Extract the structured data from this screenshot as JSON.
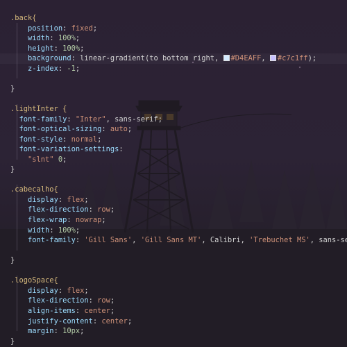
{
  "editor": {
    "lines": [
      [
        {
          "t": ".back{",
          "c": "sel"
        }
      ],
      [
        {
          "t": "    "
        },
        {
          "t": "position",
          "c": "prop"
        },
        {
          "t": ": "
        },
        {
          "t": "fixed",
          "c": "val"
        },
        {
          "t": ";"
        }
      ],
      [
        {
          "t": "    "
        },
        {
          "t": "width",
          "c": "prop"
        },
        {
          "t": ": "
        },
        {
          "t": "100%",
          "c": "num"
        },
        {
          "t": ";"
        }
      ],
      [
        {
          "t": "    "
        },
        {
          "t": "height",
          "c": "prop"
        },
        {
          "t": ": "
        },
        {
          "t": "100%",
          "c": "num"
        },
        {
          "t": ";"
        }
      ],
      [
        {
          "t": "    "
        },
        {
          "t": "background",
          "c": "prop"
        },
        {
          "t": ": linear-gradient(to bottom right, "
        },
        {
          "sw": "#D4EAFF"
        },
        {
          "t": "#D4EAFF",
          "c": "val"
        },
        {
          "t": ", "
        },
        {
          "sw": "#c7c1ff"
        },
        {
          "t": "#c7c1ff",
          "c": "val"
        },
        {
          "t": ");"
        }
      ],
      [
        {
          "t": "    "
        },
        {
          "t": "z-index",
          "c": "prop"
        },
        {
          "t": ": "
        },
        {
          "t": "-1",
          "c": "num"
        },
        {
          "t": ";"
        }
      ],
      [],
      [
        {
          "t": "}"
        }
      ],
      [],
      [
        {
          "t": ".lightInter {",
          "c": "sel"
        }
      ],
      [
        {
          "t": "  "
        },
        {
          "t": "font-family",
          "c": "prop"
        },
        {
          "t": ": "
        },
        {
          "t": "\"Inter\"",
          "c": "val"
        },
        {
          "t": ", sans-serif;"
        }
      ],
      [
        {
          "t": "  "
        },
        {
          "t": "font-optical-sizing",
          "c": "prop"
        },
        {
          "t": ": "
        },
        {
          "t": "auto",
          "c": "val"
        },
        {
          "t": ";"
        }
      ],
      [
        {
          "t": "  "
        },
        {
          "t": "font-style",
          "c": "prop"
        },
        {
          "t": ": "
        },
        {
          "t": "normal",
          "c": "val"
        },
        {
          "t": ";"
        }
      ],
      [
        {
          "t": "  "
        },
        {
          "t": "font-variation-settings",
          "c": "prop"
        },
        {
          "t": ":"
        }
      ],
      [
        {
          "t": "    "
        },
        {
          "t": "\"slnt\"",
          "c": "val"
        },
        {
          "t": " "
        },
        {
          "t": "0",
          "c": "num"
        },
        {
          "t": ";"
        }
      ],
      [
        {
          "t": "}"
        }
      ],
      [],
      [
        {
          "t": ".cabecalho{",
          "c": "sel"
        }
      ],
      [
        {
          "t": "    "
        },
        {
          "t": "display",
          "c": "prop"
        },
        {
          "t": ": "
        },
        {
          "t": "flex",
          "c": "val"
        },
        {
          "t": ";"
        }
      ],
      [
        {
          "t": "    "
        },
        {
          "t": "flex-direction",
          "c": "prop"
        },
        {
          "t": ": "
        },
        {
          "t": "row",
          "c": "val"
        },
        {
          "t": ";"
        }
      ],
      [
        {
          "t": "    "
        },
        {
          "t": "flex-wrap",
          "c": "prop"
        },
        {
          "t": ": "
        },
        {
          "t": "nowrap",
          "c": "val"
        },
        {
          "t": ";"
        }
      ],
      [
        {
          "t": "    "
        },
        {
          "t": "width",
          "c": "prop"
        },
        {
          "t": ": "
        },
        {
          "t": "100%",
          "c": "num"
        },
        {
          "t": ";"
        }
      ],
      [
        {
          "t": "    "
        },
        {
          "t": "font-family",
          "c": "prop"
        },
        {
          "t": ": "
        },
        {
          "t": "'Gill Sans'",
          "c": "val"
        },
        {
          "t": ", "
        },
        {
          "t": "'Gill Sans MT'",
          "c": "val"
        },
        {
          "t": ", Calibri, "
        },
        {
          "t": "'Trebuchet MS'",
          "c": "val"
        },
        {
          "t": ", sans-serif;"
        }
      ],
      [],
      [
        {
          "t": "}"
        }
      ],
      [],
      [
        {
          "t": ".logoSpace{",
          "c": "sel"
        }
      ],
      [
        {
          "t": "    "
        },
        {
          "t": "display",
          "c": "prop"
        },
        {
          "t": ": "
        },
        {
          "t": "flex",
          "c": "val"
        },
        {
          "t": ";"
        }
      ],
      [
        {
          "t": "    "
        },
        {
          "t": "flex-direction",
          "c": "prop"
        },
        {
          "t": ": "
        },
        {
          "t": "row",
          "c": "val"
        },
        {
          "t": ";"
        }
      ],
      [
        {
          "t": "    "
        },
        {
          "t": "align-items",
          "c": "prop"
        },
        {
          "t": ": "
        },
        {
          "t": "center",
          "c": "val"
        },
        {
          "t": ";"
        }
      ],
      [
        {
          "t": "    "
        },
        {
          "t": "justify-content",
          "c": "prop"
        },
        {
          "t": ": "
        },
        {
          "t": "center",
          "c": "val"
        },
        {
          "t": ";"
        }
      ],
      [
        {
          "t": "    "
        },
        {
          "t": "margin",
          "c": "prop"
        },
        {
          "t": ": "
        },
        {
          "t": "10px",
          "c": "num"
        },
        {
          "t": ";"
        }
      ],
      [
        {
          "t": "}"
        }
      ]
    ]
  },
  "colors": {
    "selector": "#d7ba7d",
    "property": "#9cdcfe",
    "string": "#ce9178",
    "number": "#b5cea8",
    "punctuation": "#d4d4d4"
  },
  "wallpaper": {
    "scene": "fire lookout tower in forest at night",
    "icons": [
      "lookout-tower-icon",
      "pine-tree-icon"
    ]
  }
}
